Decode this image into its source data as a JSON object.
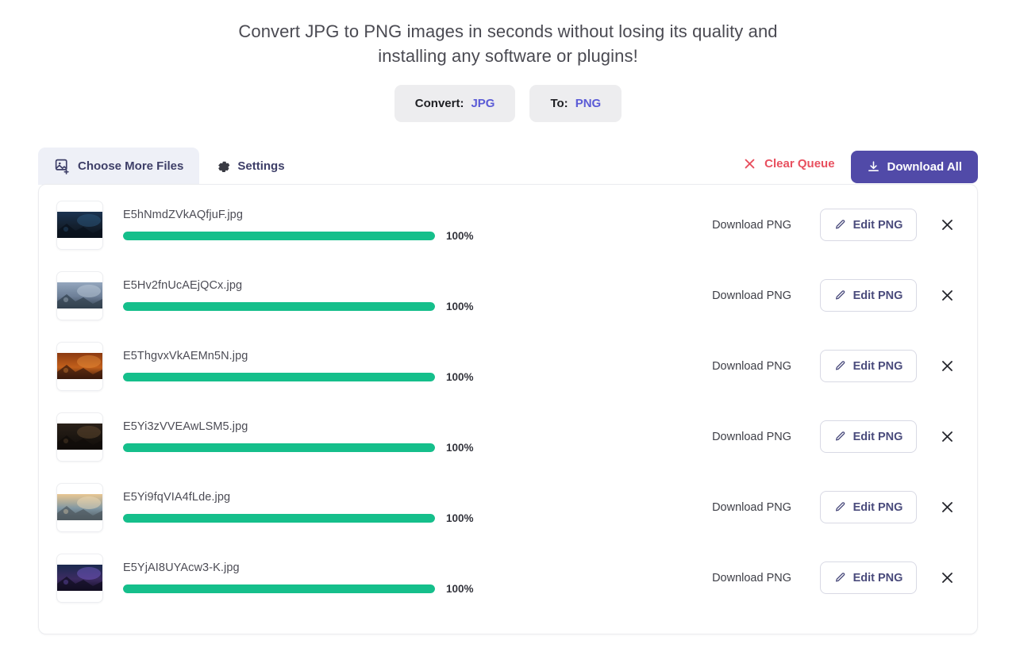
{
  "headline": {
    "line1": "Convert JPG to PNG images in seconds without losing its quality and",
    "line2": "installing any software or plugins!"
  },
  "format_selector": {
    "convert": {
      "label": "Convert:",
      "value": "JPG"
    },
    "to": {
      "label": "To:",
      "value": "PNG"
    }
  },
  "toolbar": {
    "tabs": [
      {
        "label": "Choose More Files",
        "icon": "image-add-icon",
        "active": true
      },
      {
        "label": "Settings",
        "icon": "gear-icon",
        "active": false
      }
    ],
    "clear_queue_label": "Clear Queue",
    "clear_queue_icon": "close-x-icon",
    "download_all_label": "Download All",
    "download_all_icon": "download-icon"
  },
  "colors": {
    "accent_purple": "#514aa8",
    "progress_green": "#15bf8b",
    "danger_red": "#e8505f",
    "value_indigo": "#5b5bd6",
    "tab_active_bg": "#eef0f7",
    "pill_bg": "#ededef"
  },
  "row_actions": {
    "download_label": "Download PNG",
    "edit_label": "Edit PNG",
    "edit_icon": "pencil-icon",
    "remove_icon": "close-x-icon"
  },
  "files": [
    {
      "name": "E5hNmdZVkAQfjuF.jpg",
      "progress": 100,
      "progress_label": "100%",
      "thumb": {
        "top": "#1b3350",
        "mid": "#14202f",
        "bottom": "#0a121c",
        "accent": "#2e5d86"
      }
    },
    {
      "name": "E5Hv2fnUcAEjQCx.jpg",
      "progress": 100,
      "progress_label": "100%",
      "thumb": {
        "top": "#93a6bd",
        "mid": "#6c7e96",
        "bottom": "#33414f",
        "accent": "#c3d0dd"
      }
    },
    {
      "name": "E5ThgvxVkAEMn5N.jpg",
      "progress": 100,
      "progress_label": "100%",
      "thumb": {
        "top": "#8c3a11",
        "mid": "#c2601b",
        "bottom": "#3a1a0c",
        "accent": "#e8913c"
      }
    },
    {
      "name": "E5Yi3zVVEAwLSM5.jpg",
      "progress": 100,
      "progress_label": "100%",
      "thumb": {
        "top": "#2a2119",
        "mid": "#1b1510",
        "bottom": "#100c09",
        "accent": "#6b4f33"
      }
    },
    {
      "name": "E5Yi9fqVIA4fLde.jpg",
      "progress": 100,
      "progress_label": "100%",
      "thumb": {
        "top": "#e9c792",
        "mid": "#7f96a2",
        "bottom": "#4f5a60",
        "accent": "#f2ddb7"
      }
    },
    {
      "name": "E5YjAI8UYAcw3-K.jpg",
      "progress": 100,
      "progress_label": "100%",
      "thumb": {
        "top": "#1a2a4e",
        "mid": "#3c2b62",
        "bottom": "#120d22",
        "accent": "#7b5fd0"
      }
    }
  ]
}
